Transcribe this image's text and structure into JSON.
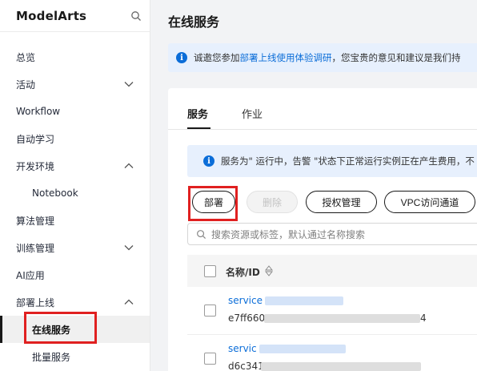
{
  "sidebar": {
    "brand": "ModelArts",
    "search_icon": "search-icon",
    "items": [
      {
        "label": "总览"
      },
      {
        "label": "活动",
        "chevron": "down"
      },
      {
        "label": "Workflow"
      },
      {
        "label": "自动学习"
      },
      {
        "label": "开发环境",
        "chevron": "up"
      },
      {
        "label": "Notebook",
        "sub": true
      },
      {
        "label": "算法管理"
      },
      {
        "label": "训练管理",
        "chevron": "down"
      },
      {
        "label": "AI应用"
      },
      {
        "label": "部署上线",
        "chevron": "up"
      },
      {
        "label": "在线服务",
        "sub": true,
        "active": true
      },
      {
        "label": "批量服务",
        "sub": true
      }
    ]
  },
  "page": {
    "title": "在线服务",
    "banner": {
      "prefix": "诚邀您参加",
      "link": "部署上线使用体验调研",
      "suffix": "，您宝贵的意见和建议是我们持"
    }
  },
  "tabs": [
    {
      "label": "服务",
      "active": true
    },
    {
      "label": "作业",
      "active": false
    }
  ],
  "notice": {
    "text": "服务为\" 运行中，告警 \"状态下正常运行实例正在产生费用，不"
  },
  "toolbar": {
    "deploy_label": "部署",
    "delete_label": "删除",
    "auth_label": "授权管理",
    "vpc_label": "VPC访问通道"
  },
  "search": {
    "placeholder": "搜索资源或标签，默认通过名称搜索"
  },
  "table": {
    "header_name": "名称/ID",
    "rows": [
      {
        "name": "service",
        "id_prefix": "e7ff660",
        "id_suffix": "4"
      },
      {
        "name": "servic",
        "id_prefix": "d6c341",
        "id_suffix": ""
      }
    ]
  },
  "colors": {
    "accent_blue": "#0b6dd8",
    "highlight_red": "#e02020",
    "banner_bg": "#e7f0fd"
  }
}
